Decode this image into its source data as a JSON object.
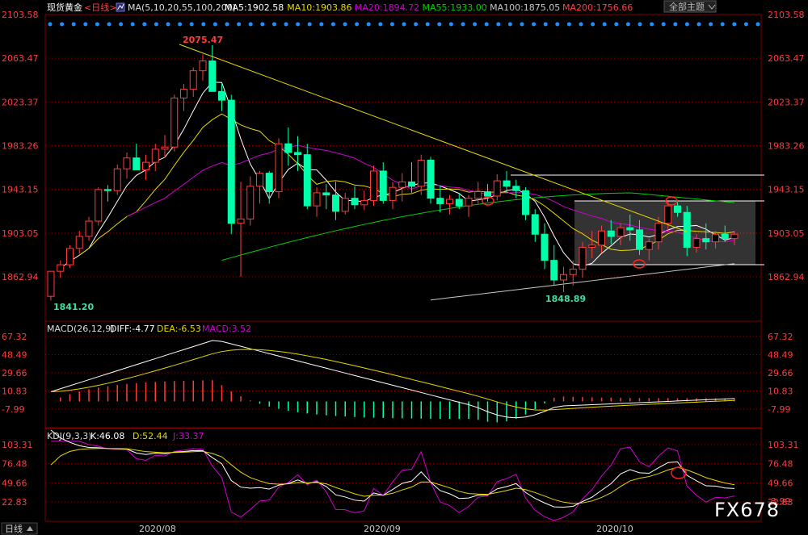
{
  "header": {
    "symbol_label": "现货黄金",
    "period_label": "<日线>",
    "ma_icon": "ma-indicator-icon",
    "ma_params": "MA(5,10,20,55,100,200)",
    "ma_values": [
      {
        "text": "MA5:1902.58",
        "color": "#ffffff"
      },
      {
        "text": "MA10:1903.86",
        "color": "#e6d800"
      },
      {
        "text": "MA20:1894.72",
        "color": "#d000d0"
      },
      {
        "text": "MA55:1933.00",
        "color": "#00d000"
      },
      {
        "text": "MA100:1875.05",
        "color": "#c8c8c8"
      },
      {
        "text": "MA200:1756.66",
        "color": "#ff4040"
      }
    ],
    "theme_button": "全部主题",
    "theme_icon": "chevron-down-icon"
  },
  "colors": {
    "up": "#ff3b3b",
    "down": "#00ffaa",
    "ma5": "#ffffff",
    "ma10": "#e6d800",
    "ma20": "#d000d0",
    "ma55": "#00d000",
    "ma100": "#c8c8c8",
    "trendline": "#e6d800",
    "axis_text": "#ff3b3b",
    "grid": "#8a0000"
  },
  "price_axis_ticks": [
    "2103.58",
    "2063.47",
    "2023.37",
    "1983.26",
    "1943.15",
    "1903.05",
    "1862.94"
  ],
  "annotations": {
    "high": "2075.47",
    "low_start": "1841.20",
    "low_mid": "1848.89"
  },
  "macd_panel": {
    "title": "MACD(26,12,9)",
    "diff": "DIFF:-4.77",
    "dea": "DEA:-6.53",
    "macd": "MACD:3.52",
    "ticks": [
      "67.32",
      "48.49",
      "29.66",
      "10.83",
      "-7.99"
    ]
  },
  "kdj_panel": {
    "title": "KDJ(9,3,3)",
    "k": "K:46.08",
    "d": "D:52.44",
    "j": "J:33.37",
    "ticks": [
      "103.31",
      "76.48",
      "49.66",
      "22.83"
    ],
    "bottom_tick": "-3.99"
  },
  "date_axis": {
    "tab_label": "日线",
    "tab_icon": "chevron-up-icon",
    "labels": [
      "2020/08",
      "2020/09",
      "2020/10"
    ]
  },
  "watermark": "FX678",
  "chart_data": {
    "type": "candlestick",
    "title": "现货黄金 <日线>",
    "ylim": [
      1841.2,
      2103.58
    ],
    "x": [
      "2020/08",
      "2020/09",
      "2020/10"
    ],
    "series": [
      {
        "name": "MA5",
        "values": [
          1902.58
        ]
      },
      {
        "name": "MA10",
        "values": [
          1903.86
        ]
      },
      {
        "name": "MA20",
        "values": [
          1894.72
        ]
      },
      {
        "name": "MA55",
        "values": [
          1933.0
        ]
      },
      {
        "name": "MA100",
        "values": [
          1875.05
        ]
      },
      {
        "name": "MA200",
        "values": [
          1756.66
        ]
      }
    ],
    "candles": [
      {
        "o": 1845,
        "h": 1851,
        "l": 1841.2,
        "c": 1868
      },
      {
        "o": 1868,
        "h": 1878,
        "l": 1862,
        "c": 1874
      },
      {
        "o": 1874,
        "h": 1892,
        "l": 1871,
        "c": 1889
      },
      {
        "o": 1889,
        "h": 1905,
        "l": 1884,
        "c": 1900
      },
      {
        "o": 1900,
        "h": 1918,
        "l": 1896,
        "c": 1914
      },
      {
        "o": 1914,
        "h": 1945,
        "l": 1910,
        "c": 1943
      },
      {
        "o": 1943,
        "h": 1947,
        "l": 1932,
        "c": 1942
      },
      {
        "o": 1942,
        "h": 1966,
        "l": 1938,
        "c": 1962
      },
      {
        "o": 1962,
        "h": 1977,
        "l": 1953,
        "c": 1972
      },
      {
        "o": 1972,
        "h": 1985,
        "l": 1963,
        "c": 1961
      },
      {
        "o": 1961,
        "h": 1975,
        "l": 1952,
        "c": 1968
      },
      {
        "o": 1968,
        "h": 1985,
        "l": 1960,
        "c": 1980
      },
      {
        "o": 1980,
        "h": 1993,
        "l": 1972,
        "c": 1982
      },
      {
        "o": 1982,
        "h": 2030,
        "l": 1978,
        "c": 2027
      },
      {
        "o": 2027,
        "h": 2040,
        "l": 2015,
        "c": 2035
      },
      {
        "o": 2035,
        "h": 2055,
        "l": 2028,
        "c": 2052
      },
      {
        "o": 2052,
        "h": 2067,
        "l": 2043,
        "c": 2061
      },
      {
        "o": 2061,
        "h": 2075.47,
        "l": 2048,
        "c": 2033
      },
      {
        "o": 2033,
        "h": 2040,
        "l": 2015,
        "c": 2025
      },
      {
        "o": 2025,
        "h": 2030,
        "l": 1902,
        "c": 1912
      },
      {
        "o": 1912,
        "h": 1950,
        "l": 1863,
        "c": 1916
      },
      {
        "o": 1916,
        "h": 1955,
        "l": 1910,
        "c": 1946
      },
      {
        "o": 1946,
        "h": 1960,
        "l": 1930,
        "c": 1958
      },
      {
        "o": 1958,
        "h": 1960,
        "l": 1930,
        "c": 1941
      },
      {
        "o": 1941,
        "h": 1990,
        "l": 1935,
        "c": 1985
      },
      {
        "o": 1985,
        "h": 2000,
        "l": 1965,
        "c": 1977
      },
      {
        "o": 1977,
        "h": 1992,
        "l": 1960,
        "c": 1975
      },
      {
        "o": 1975,
        "h": 1985,
        "l": 1925,
        "c": 1928
      },
      {
        "o": 1928,
        "h": 1945,
        "l": 1918,
        "c": 1940
      },
      {
        "o": 1940,
        "h": 1948,
        "l": 1925,
        "c": 1938
      },
      {
        "o": 1938,
        "h": 1950,
        "l": 1915,
        "c": 1923
      },
      {
        "o": 1923,
        "h": 1940,
        "l": 1920,
        "c": 1935
      },
      {
        "o": 1935,
        "h": 1946,
        "l": 1925,
        "c": 1929
      },
      {
        "o": 1929,
        "h": 1942,
        "l": 1924,
        "c": 1933
      },
      {
        "o": 1933,
        "h": 1965,
        "l": 1928,
        "c": 1960
      },
      {
        "o": 1960,
        "h": 1968,
        "l": 1930,
        "c": 1933
      },
      {
        "o": 1933,
        "h": 1950,
        "l": 1925,
        "c": 1945
      },
      {
        "o": 1945,
        "h": 1958,
        "l": 1932,
        "c": 1950
      },
      {
        "o": 1950,
        "h": 1968,
        "l": 1940,
        "c": 1946
      },
      {
        "o": 1946,
        "h": 1975,
        "l": 1938,
        "c": 1970
      },
      {
        "o": 1970,
        "h": 1973,
        "l": 1930,
        "c": 1935
      },
      {
        "o": 1935,
        "h": 1947,
        "l": 1922,
        "c": 1930
      },
      {
        "o": 1930,
        "h": 1938,
        "l": 1920,
        "c": 1934
      },
      {
        "o": 1934,
        "h": 1940,
        "l": 1925,
        "c": 1928
      },
      {
        "o": 1928,
        "h": 1938,
        "l": 1918,
        "c": 1935
      },
      {
        "o": 1935,
        "h": 1950,
        "l": 1930,
        "c": 1941
      },
      {
        "o": 1941,
        "h": 1948,
        "l": 1932,
        "c": 1937
      },
      {
        "o": 1937,
        "h": 1957,
        "l": 1933,
        "c": 1951
      },
      {
        "o": 1951,
        "h": 1960,
        "l": 1940,
        "c": 1946
      },
      {
        "o": 1946,
        "h": 1952,
        "l": 1935,
        "c": 1942
      },
      {
        "o": 1942,
        "h": 1945,
        "l": 1915,
        "c": 1920
      },
      {
        "o": 1920,
        "h": 1925,
        "l": 1895,
        "c": 1902
      },
      {
        "o": 1902,
        "h": 1912,
        "l": 1870,
        "c": 1878
      },
      {
        "o": 1878,
        "h": 1892,
        "l": 1855,
        "c": 1860
      },
      {
        "o": 1860,
        "h": 1872,
        "l": 1848.89,
        "c": 1865
      },
      {
        "o": 1865,
        "h": 1878,
        "l": 1855,
        "c": 1870
      },
      {
        "o": 1870,
        "h": 1895,
        "l": 1862,
        "c": 1890
      },
      {
        "o": 1890,
        "h": 1905,
        "l": 1880,
        "c": 1892
      },
      {
        "o": 1892,
        "h": 1910,
        "l": 1885,
        "c": 1905
      },
      {
        "o": 1905,
        "h": 1915,
        "l": 1893,
        "c": 1900
      },
      {
        "o": 1900,
        "h": 1912,
        "l": 1892,
        "c": 1908
      },
      {
        "o": 1908,
        "h": 1920,
        "l": 1896,
        "c": 1906
      },
      {
        "o": 1906,
        "h": 1915,
        "l": 1883,
        "c": 1888
      },
      {
        "o": 1888,
        "h": 1898,
        "l": 1878,
        "c": 1895
      },
      {
        "o": 1895,
        "h": 1918,
        "l": 1888,
        "c": 1912
      },
      {
        "o": 1912,
        "h": 1932,
        "l": 1905,
        "c": 1928
      },
      {
        "o": 1928,
        "h": 1932,
        "l": 1918,
        "c": 1922
      },
      {
        "o": 1922,
        "h": 1928,
        "l": 1882,
        "c": 1890
      },
      {
        "o": 1890,
        "h": 1902,
        "l": 1885,
        "c": 1898
      },
      {
        "o": 1898,
        "h": 1912,
        "l": 1888,
        "c": 1895
      },
      {
        "o": 1895,
        "h": 1905,
        "l": 1889,
        "c": 1902
      },
      {
        "o": 1902,
        "h": 1910,
        "l": 1895,
        "c": 1898
      },
      {
        "o": 1898,
        "h": 1905,
        "l": 1892,
        "c": 1902
      }
    ]
  }
}
